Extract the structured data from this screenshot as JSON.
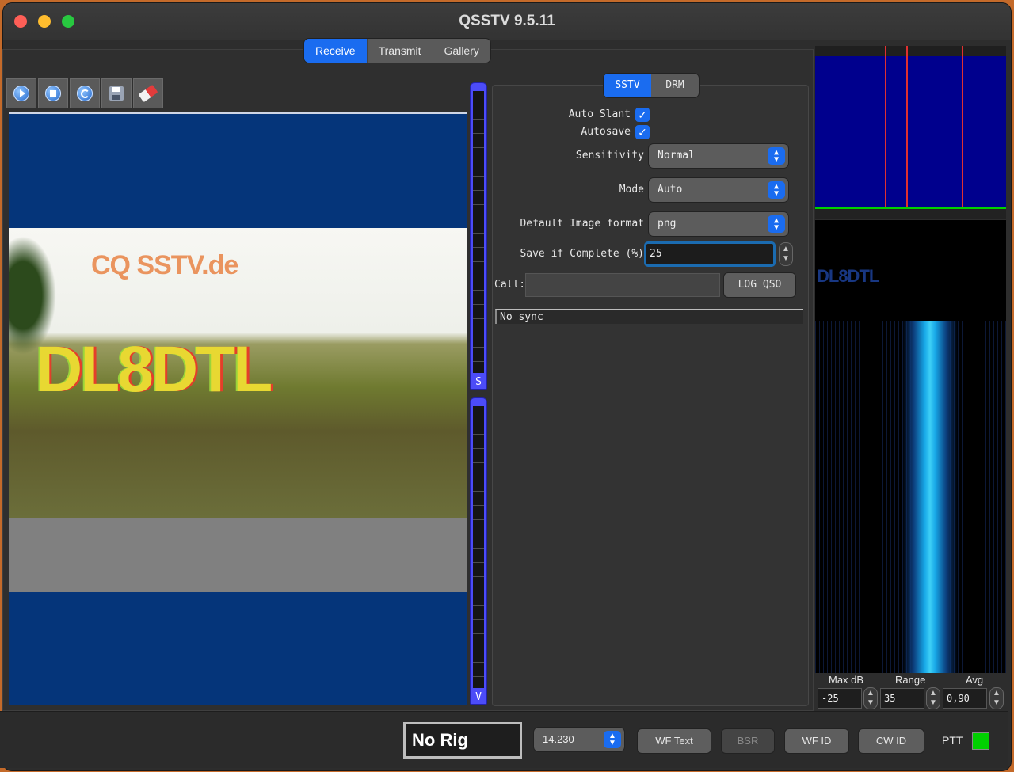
{
  "window": {
    "title": "QSSTV 9.5.11"
  },
  "main_tabs": [
    {
      "label": "Receive",
      "active": true
    },
    {
      "label": "Transmit",
      "active": false
    },
    {
      "label": "Gallery",
      "active": false
    }
  ],
  "toolbar": {
    "icons": [
      "play-icon",
      "stop-icon",
      "refresh-icon",
      "save-icon",
      "eraser-icon"
    ]
  },
  "image": {
    "overlay_top": "CQ SSTV.de",
    "overlay_main": "DL8DTL"
  },
  "sliders": {
    "sync_label": "S",
    "volume_label": "V"
  },
  "sstv_tabs": [
    {
      "label": "SSTV",
      "active": true
    },
    {
      "label": "DRM",
      "active": false
    }
  ],
  "settings": {
    "auto_slant_label": "Auto Slant",
    "auto_slant_checked": true,
    "autosave_label": "Autosave",
    "autosave_checked": true,
    "sensitivity_label": "Sensitivity",
    "sensitivity_value": "Normal",
    "mode_label": "Mode",
    "mode_value": "Auto",
    "image_format_label": "Default Image format",
    "image_format_value": "png",
    "save_complete_label": "Save if Complete (%)",
    "save_complete_value": "25",
    "call_label": "Call:",
    "call_value": "",
    "log_qso_label": "LOG QSO",
    "status_text": "No sync"
  },
  "waterfall": {
    "overlay_text": "DL8DTL",
    "max_db_label": "Max dB",
    "max_db_value": "-25",
    "range_label": "Range",
    "range_value": "35",
    "avg_label": "Avg",
    "avg_value": "0,90"
  },
  "bottom": {
    "rig_label": "No Rig",
    "frequency": "14.230",
    "wf_text_label": "WF Text",
    "bsr_label": "BSR",
    "wf_id_label": "WF ID",
    "cw_id_label": "CW ID",
    "ptt_label": "PTT"
  },
  "colors": {
    "accent": "#1a6cf0",
    "ptt_on": "#00d000",
    "image_bg": "#05357a",
    "spectrum_bg": "#00008d"
  }
}
